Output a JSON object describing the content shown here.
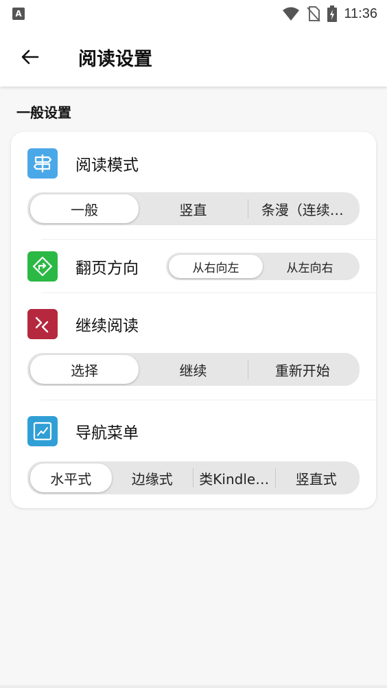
{
  "status_bar": {
    "time": "11:36",
    "notif_letter": "A"
  },
  "app_bar": {
    "title": "阅读设置"
  },
  "section": {
    "title": "一般设置"
  },
  "settings": {
    "reading_mode": {
      "label": "阅读模式",
      "options": [
        "一般",
        "竖直",
        "条漫（连续…"
      ],
      "selected": 0
    },
    "page_direction": {
      "label": "翻页方向",
      "options": [
        "从右向左",
        "从左向右"
      ],
      "selected": 0
    },
    "continue_reading": {
      "label": "继续阅读",
      "options": [
        "选择",
        "继续",
        "重新开始"
      ],
      "selected": 0
    },
    "nav_menu": {
      "label": "导航菜单",
      "options": [
        "水平式",
        "边缘式",
        "类Kindle…",
        "竖直式"
      ],
      "selected": 0
    }
  },
  "colors": {
    "reading_mode_icon": "#4aa8e8",
    "page_direction_icon": "#2bb844",
    "continue_reading_icon": "#b5283e",
    "nav_menu_icon": "#2f9fd6"
  }
}
